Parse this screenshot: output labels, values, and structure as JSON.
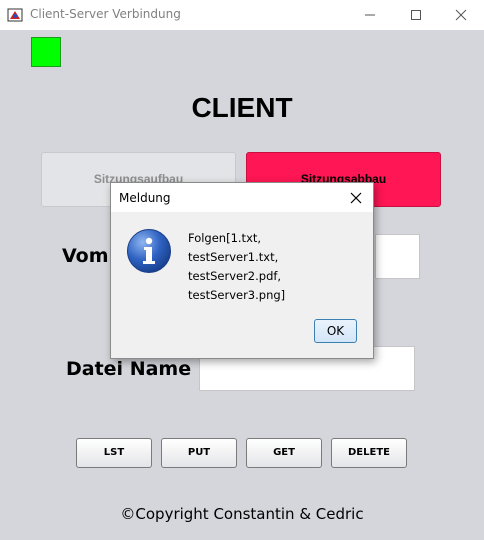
{
  "window": {
    "title": "Client-Server Verbindung",
    "icons": [
      "app-icon",
      "minimize-icon",
      "maximize-icon",
      "close-icon"
    ]
  },
  "status": {
    "color": "#00ff00"
  },
  "main": {
    "heading": "CLIENT",
    "session_start_label": "Sitzungsaufbau",
    "session_end_label": "Sitzungsabbau",
    "from_label": "Vom",
    "filename_label": "Datei Name :",
    "filename_value": ""
  },
  "commands": {
    "lst": "LST",
    "put": "PUT",
    "get": "GET",
    "delete": "DELETE"
  },
  "footer": {
    "copyright": "©Copyright Constantin & Cedric"
  },
  "dialog": {
    "title": "Meldung",
    "icon": "info-icon",
    "lines": [
      "Folgen[1.txt,",
      "testServer1.txt,",
      "testServer2.pdf,",
      "testServer3.png]"
    ],
    "ok_label": "OK"
  },
  "colors": {
    "background": "#d5d6dc",
    "session_end_bg": "#ff1654",
    "status_green": "#00ff00"
  }
}
